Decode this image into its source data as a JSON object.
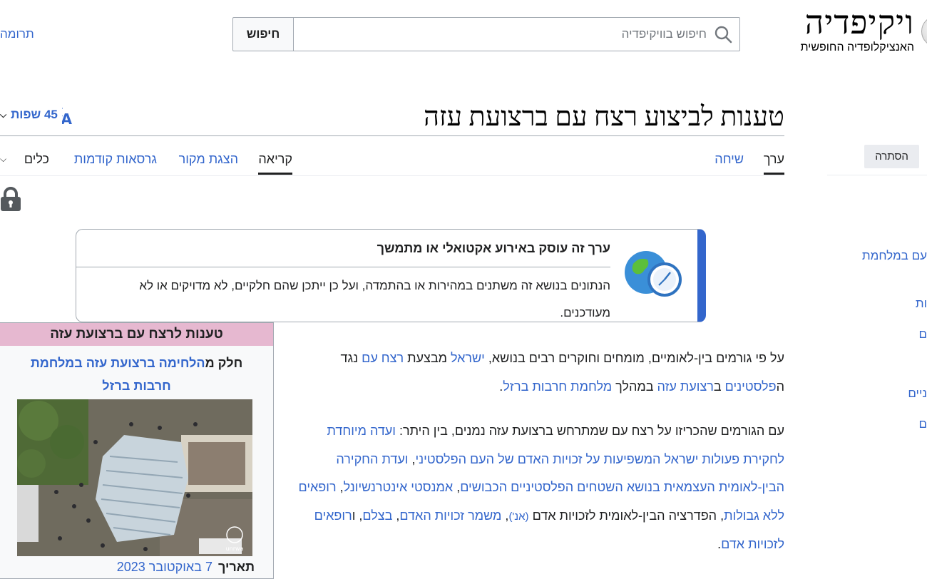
{
  "site": {
    "wordmark": "ויקיפדיה",
    "tagline": "האנציקלופדיה החופשית",
    "donate_label": "תרומה"
  },
  "search": {
    "placeholder": "חיפוש בוויקיפדיה",
    "button_label": "חיפוש"
  },
  "sidebar": {
    "hide_label": "הסתרה",
    "items": [
      {
        "label": "עם במלחמת"
      },
      {
        "label": "ות"
      },
      {
        "label": "ם"
      },
      {
        "label": "ניים"
      },
      {
        "label": "ם"
      }
    ]
  },
  "page": {
    "title": "טענות לביצוע רצח עם ברצועת עזה",
    "languages_label": "45 שפות"
  },
  "tabs": {
    "article": "ערך",
    "talk": "שיחה",
    "read": "קריאה",
    "view_source": "הצגת מקור",
    "history": "גרסאות קודמות",
    "tools": "כלים"
  },
  "notice": {
    "title": "ערך זה עוסק באירוע אקטואלי או מתמשך",
    "text": "הנתונים בנושא זה משתנים במהירות או בהתמדה, ועל כן ייתכן שהם חלקיים, לא מדויקים או לא מעודכנים."
  },
  "infobox": {
    "header": "טענות לרצח עם ברצועת עזה",
    "part_label": "חלק מ",
    "part_link": "הלחימה ברצועת עזה במלחמת חרבות ברזל",
    "date_label": "תאריך",
    "date_value": "7 באוקטובר 2023",
    "photo_badge": "unrwa"
  },
  "body": {
    "p1": {
      "t1": "על פי גורמים בין-לאומיים, מומחים וחוקרים רבים בנושא, ",
      "l1": "ישראל",
      "t2": " מבצעת ",
      "l2": "רצח עם",
      "t3": " נגד ה",
      "l3": "פלסטינים",
      "t4": " ב",
      "l4": "רצועת עזה",
      "t5": " במהלך ",
      "l5": "מלחמת חרבות ברזל",
      "t6": "."
    },
    "p2": {
      "t1": "עם הגורמים שהכריזו על רצח עם שמתרחש ברצועת עזה נמנים, בין היתר: ",
      "l1": "ועדה מיוחדת לחקירת פעולות ישראל המשפיעות על זכויות האדם של העם הפלסטיני",
      "t2": ", ",
      "l2": "ועדת החקירה הבין-לאומית העצמאית בנושא השטחים הפלסטיניים הכבושים",
      "t3": ", ",
      "l3": "אמנסטי אינטרנשיונל",
      "t4": ", ",
      "l4": "רופאים ללא גבולות",
      "t5": ", הפדרציה הבין-לאומית לזכויות אדם ",
      "l5": "(אנ')",
      "t6": ", ",
      "l6": "משמר זכויות האדם",
      "t7": ", ",
      "l7": "בצלם",
      "t8": ", ו",
      "l8": "רופאים לזכויות אדם",
      "t9": "."
    }
  },
  "colors": {
    "link": "#3366cc",
    "infobox_header": "#e6b8d0",
    "notice_accent": "#3366cc"
  },
  "icons": [
    "search-icon",
    "translate-icon",
    "lock-icon",
    "globe-clock-icon",
    "chevron-down-icon"
  ]
}
